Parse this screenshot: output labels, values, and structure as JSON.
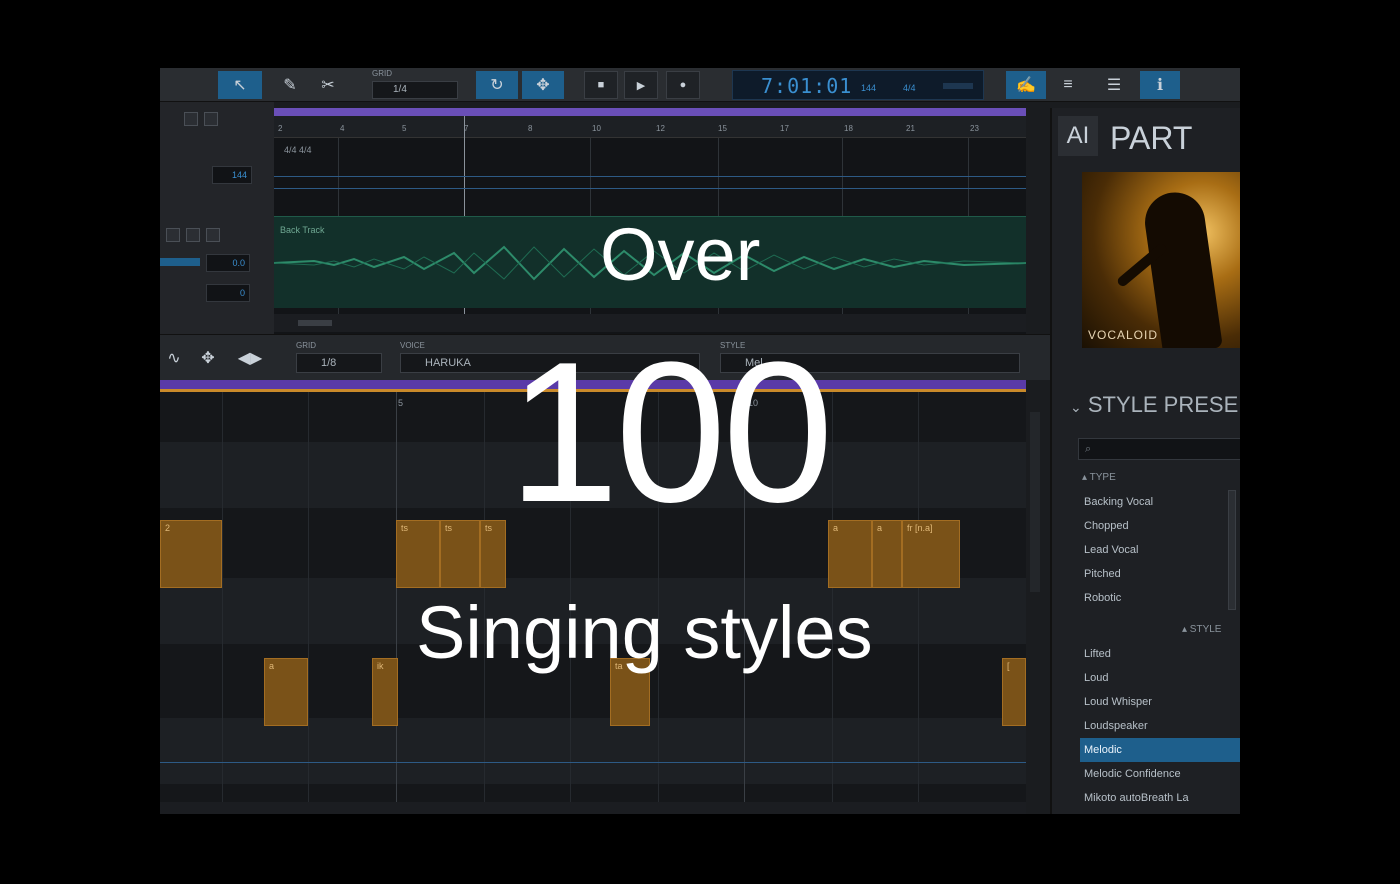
{
  "toolbar": {
    "grid_label": "GRID",
    "grid_value": "1/4",
    "time": "7:01:01",
    "tempo": "144",
    "signature": "4/4"
  },
  "arrangement": {
    "ruler_ticks": [
      "2",
      "4",
      "5",
      "7",
      "8",
      "10",
      "12",
      "15",
      "17",
      "18",
      "21",
      "23"
    ],
    "signature_label": "4/4  4/4",
    "tempo_field": "144",
    "audio_track_label": "Back Track",
    "fields": [
      "0.0",
      "0"
    ]
  },
  "editor": {
    "grid_label": "GRID",
    "grid_value": "1/8",
    "voice_label": "VOICE",
    "voice_value": "HARUKA",
    "style_label": "STYLE",
    "style_value": "Mel",
    "bar_marker_1": "5",
    "bar_marker_2": "10",
    "notes": [
      "2",
      "ts",
      "ts",
      "ts",
      "a",
      "a",
      "a",
      "fr [n.a]",
      "a",
      "ik",
      "a",
      "ta",
      "[ "
    ]
  },
  "side": {
    "ai_tag": "AI",
    "part_title": "PART",
    "voice_brand": "VOCALOID",
    "style_presets_title": "STYLE PRESE",
    "type_group": "▴ TYPE",
    "type_items": [
      "Backing Vocal",
      "Chopped",
      "Lead Vocal",
      "Pitched",
      "Robotic"
    ],
    "style_group": "▴ STYLE",
    "style_items": [
      "Lifted",
      "Loud",
      "Loud Whisper",
      "Loudspeaker",
      "Melodic",
      "Melodic Confidence",
      "Mikoto autoBreath La"
    ],
    "selected_style": "Melodic"
  },
  "overlay": {
    "line1": "Over",
    "line2": "100",
    "line3": "Singing styles"
  },
  "colors": {
    "accent_blue": "#1e5f8c",
    "note_orange": "#7a5218",
    "track_green": "#12302a",
    "timeline_purple": "#6a4fb8"
  }
}
